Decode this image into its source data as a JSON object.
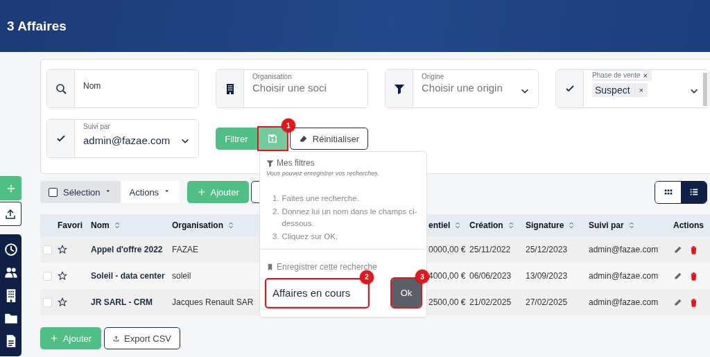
{
  "header": {
    "title": "3 Affaires"
  },
  "filters": [
    {
      "kind": "text",
      "label": "Nom"
    },
    {
      "kind": "company",
      "label": "Organisation",
      "placeholder": "Choisir une soci"
    },
    {
      "kind": "select",
      "label": "Origine",
      "placeholder": "Choisir une origin"
    },
    {
      "kind": "multi",
      "label": "Phase de vente",
      "tags": [
        {
          "remove": "×"
        },
        {
          "label": "Suspect",
          "remove": "×"
        }
      ]
    },
    {
      "kind": "user",
      "label": "Suivi par",
      "value": "admin@fazae.com"
    }
  ],
  "filter_buttons": [
    {
      "kind": "filter",
      "label": "Filtrer",
      "highlighted": false
    },
    {
      "kind": "save",
      "highlighted": true,
      "badge": "1"
    },
    {
      "kind": "reset",
      "label": "Réinitialiser",
      "highlighted": false
    }
  ],
  "saved_filters_popover": {
    "title": "Mes filtres",
    "hint": "Vous pouvez enregistrer vos recherches.",
    "steps": [
      {
        "num": "1.",
        "text": "Faites une recherche."
      },
      {
        "num": "2.",
        "text": "Donnez lui un nom dans le champs ci-dessous."
      },
      {
        "num": "3.",
        "text": "Cliquez sur OK."
      }
    ],
    "save_label": "Enregistrer cette recherche",
    "name_input": {
      "value": "Affaires en cours",
      "highlighted": true,
      "badge": "2"
    },
    "ok_button": {
      "label": "Ok",
      "highlighted": true,
      "badge": "3"
    }
  },
  "toolbar": {
    "selection": "Sélection",
    "selection_checked": false,
    "actions": "Actions",
    "add": "Ajouter",
    "view_toggle": [
      {
        "kind": "grid",
        "selected": false
      },
      {
        "kind": "list",
        "selected": true
      }
    ]
  },
  "table": {
    "favorite_column": "Favori",
    "columns": [
      {
        "label": "Nom",
        "sortable": true
      },
      {
        "label": "Organisation",
        "sortable": true
      },
      {
        "label": "entiel",
        "sortable": true
      },
      {
        "label": "Création",
        "sortable": true
      },
      {
        "label": "Signature",
        "sortable": true
      },
      {
        "label": "Suivi par",
        "sortable": true
      },
      {
        "label": "Actions",
        "sortable": false
      }
    ],
    "rows": [
      {
        "checked": false,
        "favorite": false,
        "cells": [
          "Appel d'offre 2022",
          "FAZAE",
          "0000,00 €",
          "25/11/2022",
          "25/12/2023",
          "admin@fazae.com"
        ]
      },
      {
        "checked": false,
        "favorite": false,
        "cells": [
          "Soleil - data center",
          "soleil",
          "4000,00 €",
          "06/06/2023",
          "13/09/2023",
          "admin@fazae.com"
        ]
      },
      {
        "checked": false,
        "favorite": false,
        "cells": [
          "JR SARL - CRM",
          "Jacques Renault SAR",
          "2500,00 €",
          "21/02/2025",
          "27/02/2025",
          "admin@fazae.com"
        ]
      }
    ]
  },
  "footer": {
    "add": "Ajouter",
    "export": "Export CSV"
  }
}
